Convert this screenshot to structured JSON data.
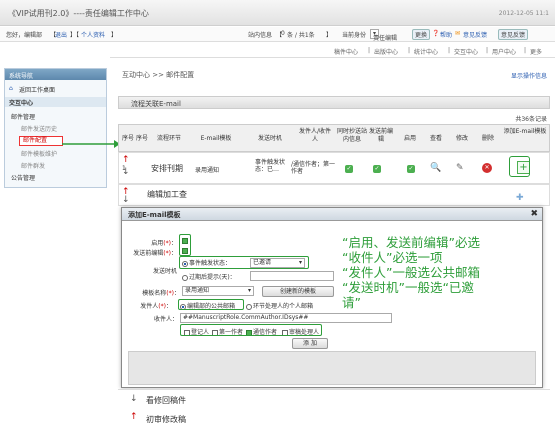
{
  "app": {
    "title": "《VIP试用刊2.0》----责任编辑工作中心",
    "date": "2012-12-05 11:1"
  },
  "userbar": {
    "greeting": "您好，编辑部",
    "logout": "退出",
    "profile": "个人资料",
    "messages_label": "站内信息",
    "messages_count": "0",
    "messages_unit": "条 / 共1条",
    "role_label": "当前身份",
    "role_value": "责任编辑",
    "switch_button": "更换",
    "help_link": "帮助",
    "feedback_link": "意见反馈",
    "suggest_button": "意见反馈"
  },
  "menu": {
    "items": [
      "稿件中心",
      "出版中心",
      "统计中心",
      "交互中心",
      "用户中心",
      "更多"
    ]
  },
  "sidebar": {
    "title": "系统导航",
    "home": "返回工作桌面",
    "section_interaction": "交互中心",
    "group_mail": "邮件管理",
    "items": [
      "邮件发送历史",
      "邮件配置",
      "邮件模板维护",
      "邮件群发"
    ],
    "group_announcement": "公告管理"
  },
  "breadcrumb": "互动中心 >> 邮件配置",
  "help_tip": "显示操作信息",
  "panel_title": "流程关联E-mail",
  "total_label": "共36条记录",
  "table": {
    "headers": [
      "序号",
      "序号",
      "流程环节",
      "E-mail模板",
      "发送时机",
      "发件人/收件人",
      "同时抄送站内信息",
      "发送前编辑",
      "启用",
      "查看",
      "修改",
      "删除",
      "添加E-mail模板"
    ],
    "rows": [
      {
        "no": "1",
        "step": "安排刊期",
        "template": "录用通知",
        "timing": "事件触发状态：已…",
        "recipients": "/通信作者；第一作者"
      },
      {
        "no": "2",
        "step": "编辑加工查"
      }
    ],
    "bottom_rows": [
      "看修回稿件",
      "初审修改稿"
    ]
  },
  "modal": {
    "title": "添加E-mail模板",
    "enable_label": "启用",
    "pre_edit_label": "发送前编辑",
    "required_mark": "(*)",
    "send_time_label": "发送时机",
    "event_trigger_label": "事件触发状态：",
    "event_trigger_value": "已邀请",
    "overdue_label": "过期后提示(天)：",
    "template_name_label": "模板名称",
    "template_name_value": "录用通知",
    "create_template_button": "创建新的模板",
    "sender_label": "发件人",
    "sender_option_public": "编辑部的公共邮箱",
    "sender_option_personal": "环节处理人的个人邮箱",
    "recipient_label": "收件人",
    "recipient_value": "##ManuscriptRole.CommAuthor.IDsys##",
    "recipient_options": [
      "登记人",
      "第一作者",
      "通信作者",
      "审稿处理人"
    ],
    "add_button": "添 加"
  },
  "annotation": {
    "lines": [
      "“启用、发送前编辑”必选",
      "“收件人”必选一项",
      "“发件人”一般选公共邮箱",
      "“发送时机”一般选“已邀",
      "请”"
    ]
  },
  "colors": {
    "annotation": "#2e9e3a",
    "active_red": "#c00000",
    "header_blue": "#5d88ad"
  }
}
